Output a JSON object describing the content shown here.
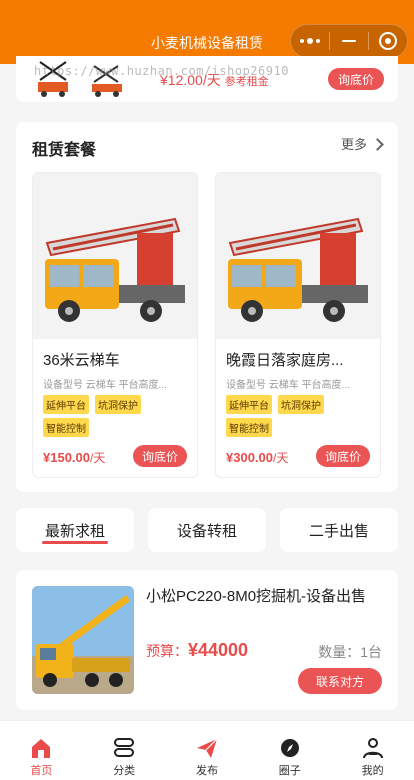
{
  "app": {
    "title": "小麦机械设备租赁",
    "watermark": "https://www.huzhan.com/ishop26910"
  },
  "top_card": {
    "price": "¥12.00/天",
    "price_note": "参考租金",
    "button": "询底价"
  },
  "packages": {
    "title": "租赁套餐",
    "more": "更多",
    "items": [
      {
        "name": "36米云梯车",
        "meta": "设备型号 云梯车 平台高度...",
        "tags": [
          "延伸平台",
          "坑洞保护",
          "智能控制"
        ],
        "price": "¥150.00",
        "unit": "/天",
        "button": "询底价"
      },
      {
        "name": "晚霞日落家庭房...",
        "meta": "设备型号 云梯车 平台高度...",
        "tags": [
          "延伸平台",
          "坑洞保护",
          "智能控制"
        ],
        "price": "¥300.00",
        "unit": "/天",
        "button": "询底价"
      }
    ]
  },
  "tabs": [
    "最新求租",
    "设备转租",
    "二手出售"
  ],
  "listing": {
    "title": "小松PC220-8M0挖掘机-设备出售",
    "budget_label": "预算：",
    "budget_value": "¥44000",
    "quantity": "数量：1台",
    "button": "联系对方"
  },
  "bottom_nav": [
    {
      "label": "首页",
      "icon": "home-icon"
    },
    {
      "label": "分类",
      "icon": "category-icon"
    },
    {
      "label": "发布",
      "icon": "send-icon"
    },
    {
      "label": "圈子",
      "icon": "compass-icon"
    },
    {
      "label": "我的",
      "icon": "user-icon"
    }
  ],
  "colors": {
    "header": "#f47a00",
    "accent": "#ea5454",
    "tag": "#ffd84d"
  }
}
